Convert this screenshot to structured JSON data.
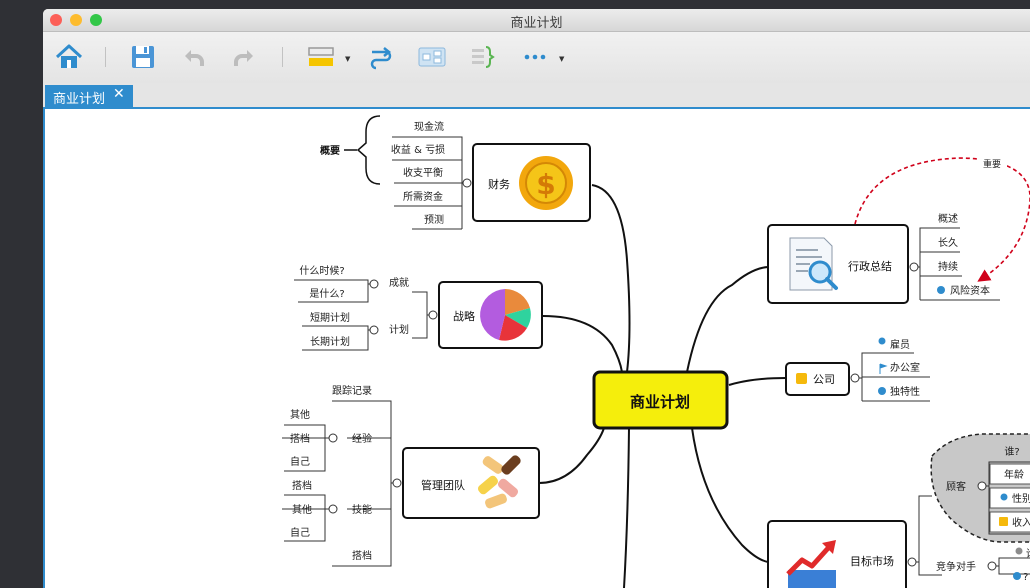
{
  "window": {
    "title": "商业计划",
    "traffic_lights": {
      "close": "#fc5f57",
      "minimize": "#fdbc2e",
      "zoom": "#33c748"
    }
  },
  "toolbar": {
    "items": [
      {
        "name": "home",
        "icon": "home-icon"
      },
      {
        "name": "save",
        "icon": "save-icon"
      },
      {
        "name": "undo",
        "icon": "undo-icon"
      },
      {
        "name": "redo",
        "icon": "redo-icon"
      },
      {
        "name": "style",
        "icon": "style-icon"
      },
      {
        "name": "relationship",
        "icon": "relationship-icon"
      },
      {
        "name": "structure",
        "icon": "structure-icon"
      },
      {
        "name": "summary",
        "icon": "summary-brace-icon"
      },
      {
        "name": "more",
        "icon": "more-icon"
      }
    ],
    "accent": "#2f8ccd"
  },
  "tab": {
    "label": "商业计划",
    "close": "✕"
  },
  "map": {
    "central": "商业计划",
    "central_color": "#f5ee0c",
    "finance": {
      "label": "财务",
      "summary_label": "概要",
      "items": [
        "现金流",
        "收益 & 亏损",
        "收支平衡",
        "所需资金",
        "预测"
      ],
      "icon_glyph": "$"
    },
    "strategy": {
      "label": "战略",
      "groups": [
        {
          "label": "成就",
          "items": [
            "什么时候?",
            "是什么?"
          ]
        },
        {
          "label": "计划",
          "items": [
            "短期计划",
            "长期计划"
          ]
        }
      ]
    },
    "team": {
      "label": "管理团队",
      "top_item": "跟踪记录",
      "groups": [
        {
          "label": "经验",
          "items": [
            "其他",
            "搭档",
            "自己"
          ]
        },
        {
          "label": "技能",
          "items": [
            "搭档",
            "其他",
            "自己"
          ]
        }
      ],
      "bottom_item": "搭档"
    },
    "exec": {
      "label": "行政总结",
      "items": [
        "概述",
        "长久",
        "持续",
        "风险资本"
      ],
      "relationship_label": "重要"
    },
    "company": {
      "label": "公司",
      "items": [
        "雇员",
        "办公室",
        "独特性"
      ]
    },
    "market": {
      "label": "目标市场",
      "customers_label": "顾客",
      "customer_items": [
        "谁?",
        "年龄",
        "性别",
        "收入"
      ],
      "competitors_label": "竞争对手",
      "competitor_items": [
        "谁",
        "?"
      ]
    }
  }
}
